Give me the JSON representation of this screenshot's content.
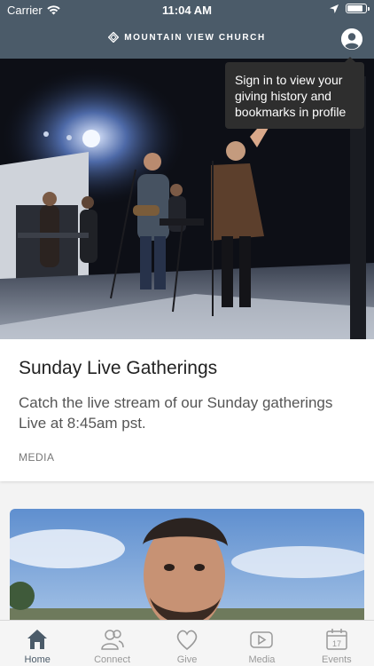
{
  "status_bar": {
    "carrier": "Carrier",
    "time": "11:04 AM"
  },
  "header": {
    "brand": "MOUNTAIN VIEW CHURCH"
  },
  "tooltip": {
    "text": "Sign in to view your giving history and bookmarks in profile"
  },
  "feed": {
    "cards": [
      {
        "title": "Sunday Live Gatherings",
        "description": "Catch the live stream of our Sunday gatherings Live at 8:45am pst.",
        "label": "MEDIA"
      }
    ]
  },
  "tabs": [
    {
      "label": "Home",
      "icon": "home-icon",
      "active": true
    },
    {
      "label": "Connect",
      "icon": "people-icon",
      "active": false
    },
    {
      "label": "Give",
      "icon": "heart-icon",
      "active": false
    },
    {
      "label": "Media",
      "icon": "play-icon",
      "active": false
    },
    {
      "label": "Events",
      "icon": "calendar-icon",
      "active": false,
      "badge": "17"
    }
  ],
  "colors": {
    "header_bg": "#4b5b69",
    "active_tab": "#4b5b69",
    "inactive_tab": "#999999",
    "tooltip_bg": "#2e2e2e"
  }
}
